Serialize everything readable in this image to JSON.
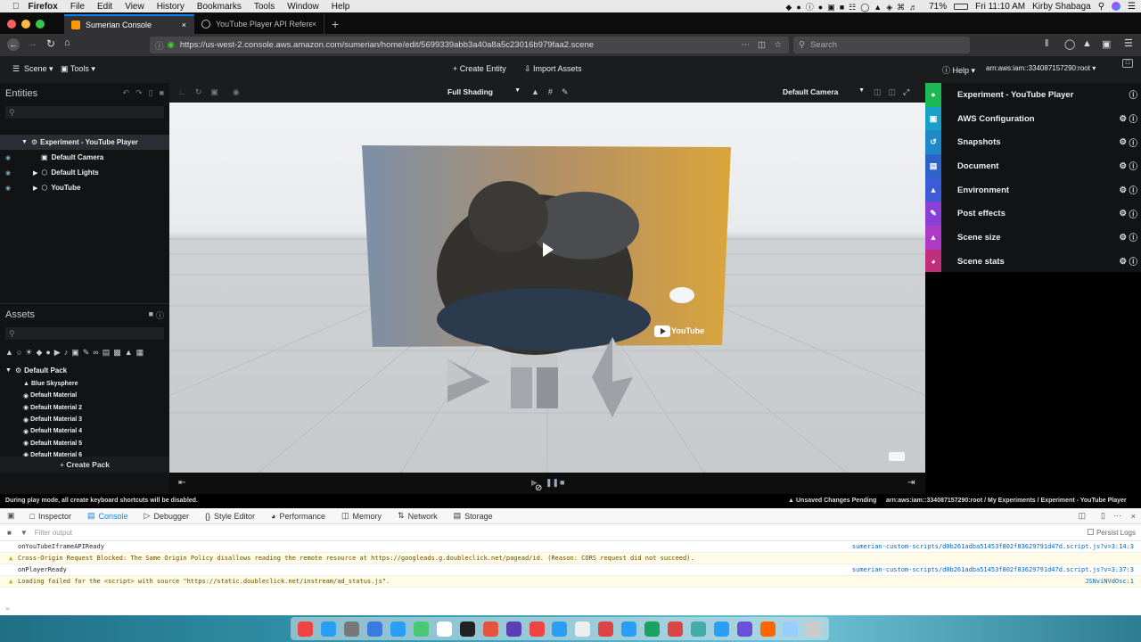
{
  "menubar": {
    "app": "Firefox",
    "items": [
      "File",
      "Edit",
      "View",
      "History",
      "Bookmarks",
      "Tools",
      "Window",
      "Help"
    ],
    "battery": "71%",
    "clock": "Fri 11:10 AM",
    "user": "Kirby Shabaga"
  },
  "tabs": [
    {
      "title": "Sumerian Console",
      "active": true
    },
    {
      "title": "YouTube Player API Reference f",
      "active": false
    }
  ],
  "navbar": {
    "url": "https://us-west-2.console.aws.amazon.com/sumerian/home/edit/5699339abb3a40a8a5c23016b979faa2.scene",
    "search_placeholder": "Search"
  },
  "sumerian_bar": {
    "scene_menu": "Scene",
    "tools_menu": "Tools",
    "create_entity": "Create Entity",
    "import_assets": "Import Assets",
    "help": "Help",
    "account": "arn:aws:iam::334087157290:root"
  },
  "entities": {
    "title": "Entities",
    "search_placeholder": "",
    "tree": [
      {
        "label": "Experiment - YouTube Player",
        "level": 0,
        "selected": true
      },
      {
        "label": "Default Camera",
        "level": 1
      },
      {
        "label": "Default Lights",
        "level": 1
      },
      {
        "label": "YouTube",
        "level": 1
      }
    ]
  },
  "assets": {
    "title": "Assets",
    "pack": "Default Pack",
    "items": [
      "Blue Skysphere",
      "Default Material",
      "Default Material 2",
      "Default Material 3",
      "Default Material 4",
      "Default Material 5",
      "Default Material 6"
    ],
    "create_pack": "Create Pack"
  },
  "viewport": {
    "shading": "Full Shading",
    "camera": "Default Camera",
    "youtube_label": "YouTube"
  },
  "right_panel": {
    "items": [
      {
        "label": "Experiment - YouTube Player",
        "color": "#1db954",
        "icon": "entity-icon"
      },
      {
        "label": "AWS Configuration",
        "color": "#18a0c8",
        "icon": "cube-icon"
      },
      {
        "label": "Snapshots",
        "color": "#1e88c8",
        "icon": "history-icon"
      },
      {
        "label": "Document",
        "color": "#2b63c8",
        "icon": "document-icon"
      },
      {
        "label": "Environment",
        "color": "#3b5bd8",
        "icon": "environment-icon"
      },
      {
        "label": "Post effects",
        "color": "#8a3fd8",
        "icon": "magic-wand-icon"
      },
      {
        "label": "Scene size",
        "color": "#b03ac8",
        "icon": "weight-icon"
      },
      {
        "label": "Scene stats",
        "color": "#c0307a",
        "icon": "gauge-icon"
      }
    ]
  },
  "status": {
    "left": "During play mode, all create keyboard shortcuts will be disabled.",
    "unsaved": "Unsaved Changes Pending",
    "breadcrumb": "arn:aws:iam::334087157290:root / My Experiments / Experiment - YouTube Player"
  },
  "devtools": {
    "tabs": [
      "Inspector",
      "Console",
      "Debugger",
      "Style Editor",
      "Performance",
      "Memory",
      "Network",
      "Storage"
    ],
    "active_tab": "Console",
    "filter_placeholder": "Filter output",
    "persist_logs": "Persist Logs",
    "lines": [
      {
        "text": "onYouTubeIframeAPIReady",
        "type": "log",
        "source": "sumerian-custom-scripts/d0b261adba51453f802f83629791d47d.script.js?v=3:14:3"
      },
      {
        "text": "Cross-Origin Request Blocked: The Same Origin Policy disallows reading the remote resource at https://googleads.g.doubleclick.net/pagead/id. (Reason: CORS request did not succeed).",
        "type": "warn",
        "source": ""
      },
      {
        "text": "onPlayerReady",
        "type": "log",
        "source": "sumerian-custom-scripts/d0b261adba51453f802f83629791d47d.script.js?v=3:37:3"
      },
      {
        "text": "Loading failed for the <script> with source \"https://static.doubleclick.net/instream/ad_status.js\".",
        "type": "warn",
        "source": "JSNviNVdOsc:1"
      }
    ]
  },
  "dock": {
    "icon_colors": [
      "#e44",
      "#2a9df4",
      "#777",
      "#3b7be0",
      "#2a9df4",
      "#48c774",
      "#fff",
      "#222",
      "#e5533d",
      "#5b3fb7",
      "#e44",
      "#2a9df4",
      "#eee",
      "#d44",
      "#2a9df4",
      "#1aa260",
      "#d44",
      "#4aa",
      "#2a9df4",
      "#6a4fd8",
      "#f60",
      "#9cf",
      "#ccc"
    ]
  }
}
